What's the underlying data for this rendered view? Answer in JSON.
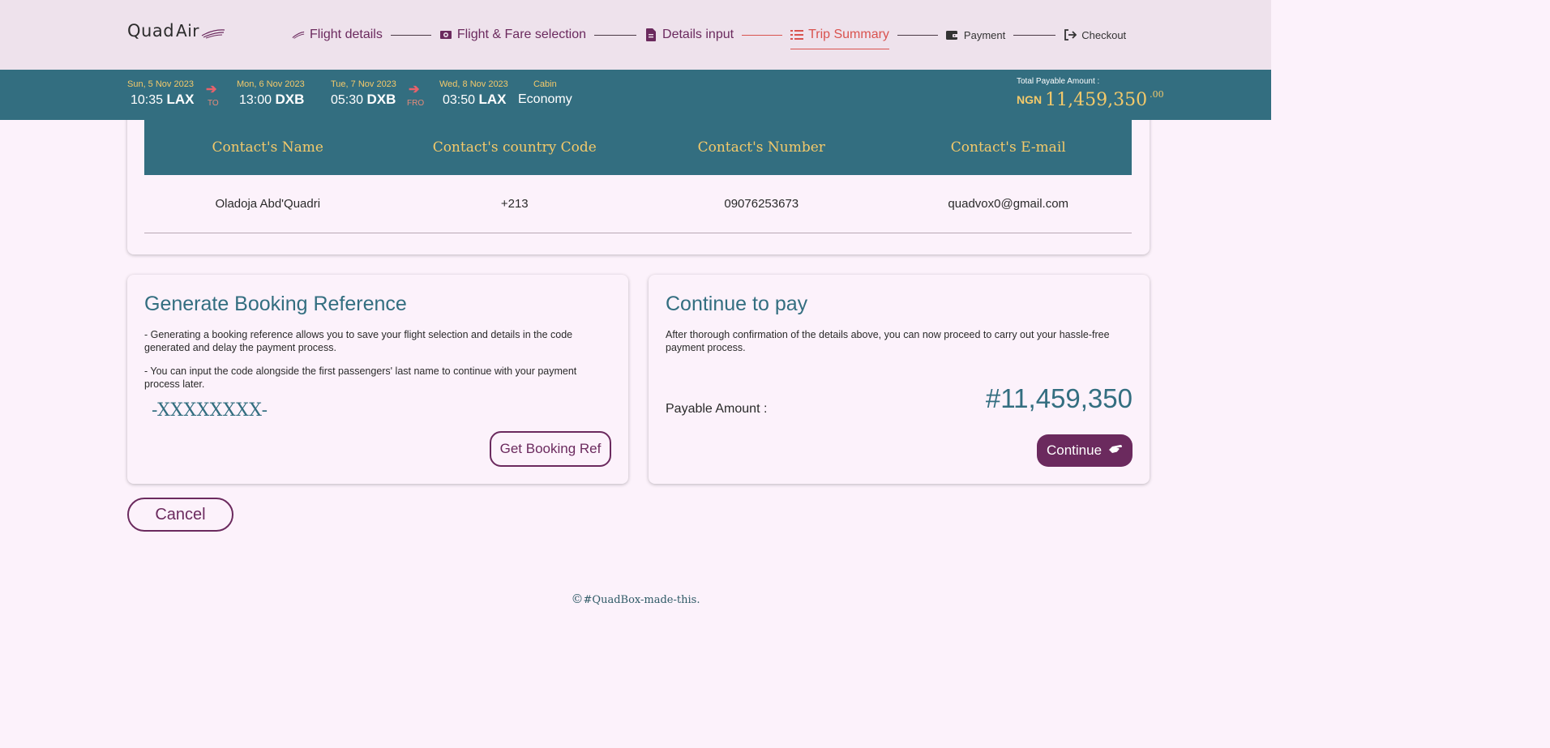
{
  "brand": {
    "logo_main": "Quad",
    "logo_sub": "Air"
  },
  "steps": [
    {
      "label": "Flight details"
    },
    {
      "label": "Flight & Fare selection"
    },
    {
      "label": "Details input"
    },
    {
      "label": "Trip Summary"
    },
    {
      "label": "Payment"
    },
    {
      "label": "Checkout"
    }
  ],
  "active_step": "Trip Summary",
  "flight": {
    "outbound": {
      "dep_date": "Sun, 5 Nov 2023",
      "dep_time": "10:35",
      "dep_code": "LAX",
      "arr_date": "Mon, 6 Nov 2023",
      "arr_time": "13:00",
      "arr_code": "DXB",
      "direction": "TO"
    },
    "return": {
      "dep_date": "Tue, 7 Nov 2023",
      "dep_time": "05:30",
      "dep_code": "DXB",
      "arr_date": "Wed, 8 Nov 2023",
      "arr_time": "03:50",
      "arr_code": "LAX",
      "direction": "FRO"
    },
    "cabin_label": "Cabin",
    "cabin_value": "Economy"
  },
  "total": {
    "label": "Total Payable Amount :",
    "currency": "NGN",
    "amount": "11,459,350",
    "decimals": ".00"
  },
  "contact": {
    "headers": [
      "Contact's Name",
      "Contact's country Code",
      "Contact's Number",
      "Contact's E-mail"
    ],
    "row": [
      "Oladoja Abd'Quadri",
      "+213",
      "09076253673",
      "quadvox0@gmail.com"
    ]
  },
  "booking": {
    "title": "Generate Booking Reference",
    "para1": "- Generating a booking reference allows you to save your flight selection and details in the code generated and delay the payment process.",
    "para2": "- You can input the code alongside the first passengers' last name to continue with your payment process later.",
    "code": "-XXXXXXXX-",
    "button": "Get Booking Ref"
  },
  "pay": {
    "title": "Continue to pay",
    "para": "After thorough confirmation of the details above, you can now proceed to carry out your hassle-free payment process.",
    "payable_label": "Payable Amount :",
    "payable_amount": "#11,459,350",
    "button": "Continue"
  },
  "cancel_button": "Cancel",
  "footer": "#QuadBox-made-this.",
  "footer_symbol": "©",
  "colors": {
    "primary": "#336e80",
    "accent": "#6b2a5e",
    "gold": "#f3c96a",
    "active": "#d9534f"
  }
}
